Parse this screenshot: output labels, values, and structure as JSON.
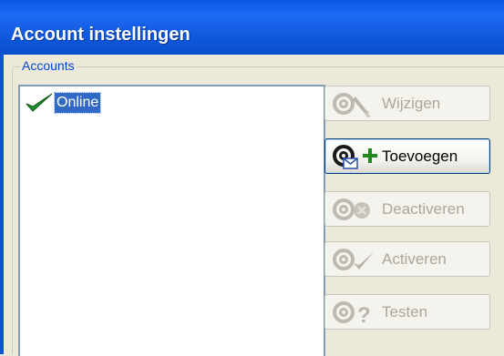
{
  "window": {
    "title": "Account instellingen"
  },
  "accounts_group": {
    "label": "Accounts",
    "items": [
      {
        "label": "Online",
        "status": "active",
        "selected": true
      }
    ]
  },
  "buttons": {
    "wijzigen": {
      "label": "Wijzigen",
      "enabled": false
    },
    "toevoegen": {
      "label": "Toevoegen",
      "enabled": true
    },
    "deactiveren": {
      "label": "Deactiveren",
      "enabled": false
    },
    "activeren": {
      "label": "Activeren",
      "enabled": false
    },
    "testen": {
      "label": "Testen",
      "enabled": false
    }
  },
  "colors": {
    "titlebar": "#0a58e6",
    "selection": "#316ac5",
    "check": "#1f8f2c",
    "add_plus": "#1e8a1e"
  }
}
